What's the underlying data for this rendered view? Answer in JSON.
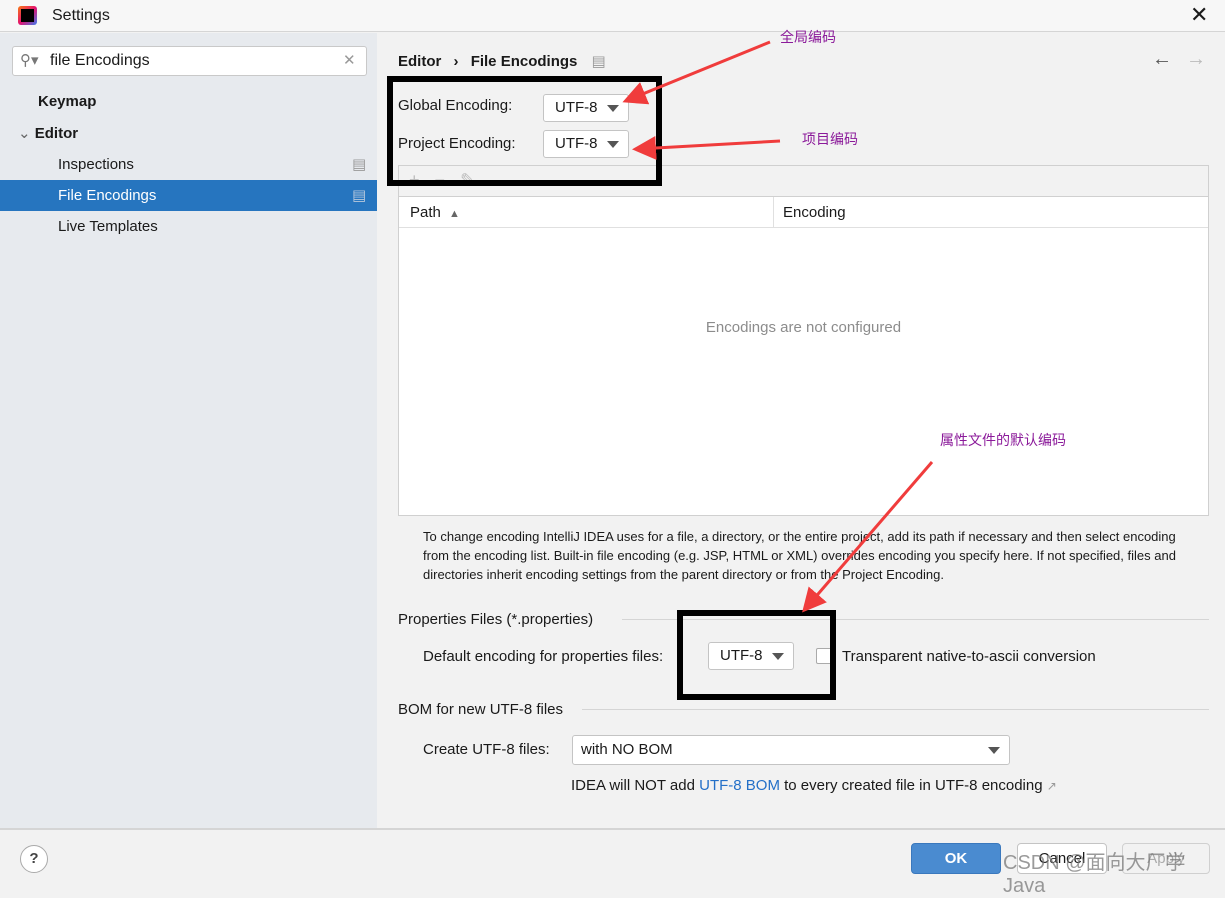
{
  "window": {
    "title": "Settings"
  },
  "search": {
    "value": "file Encodings"
  },
  "sidebar": {
    "items": [
      {
        "label": "Keymap"
      },
      {
        "label": "Editor"
      },
      {
        "label": "Inspections"
      },
      {
        "label": "File Encodings"
      },
      {
        "label": "Live Templates"
      }
    ]
  },
  "breadcrumb": {
    "parent": "Editor",
    "sep": "›",
    "current": "File Encodings"
  },
  "global_encoding": {
    "label": "Global Encoding:",
    "value": "UTF-8"
  },
  "project_encoding": {
    "label": "Project Encoding:",
    "value": "UTF-8"
  },
  "table": {
    "columns": [
      "Path",
      "Encoding"
    ],
    "empty_text": "Encodings are not configured"
  },
  "help_text": "To change encoding IntelliJ IDEA uses for a file, a directory, or the entire project, add its path if necessary and then select encoding from the encoding list. Built-in file encoding (e.g. JSP, HTML or XML) overrides encoding you specify here. If not specified, files and directories inherit encoding settings from the parent directory or from the Project Encoding.",
  "properties": {
    "section": "Properties Files (*.properties)",
    "label": "Default encoding for properties files:",
    "value": "UTF-8",
    "checkbox_label": "Transparent native-to-ascii conversion",
    "checked": false
  },
  "bom": {
    "section": "BOM for new UTF-8 files",
    "label": "Create UTF-8 files:",
    "value": "with NO BOM",
    "info_pre": "IDEA will NOT add ",
    "info_link": "UTF-8 BOM",
    "info_post": " to every created file in UTF-8 encoding"
  },
  "buttons": {
    "ok": "OK",
    "cancel": "Cancel",
    "apply": "Apply"
  },
  "annotations": {
    "global": "全局编码",
    "project": "项目编码",
    "properties": "属性文件的默认编码",
    "color": "#8b1a9a",
    "arrow_color": "#f03c3c"
  },
  "watermark": "CSDN @面向大厂学Java",
  "colors": {
    "accent": "#2675bf",
    "link": "#2470c8"
  }
}
